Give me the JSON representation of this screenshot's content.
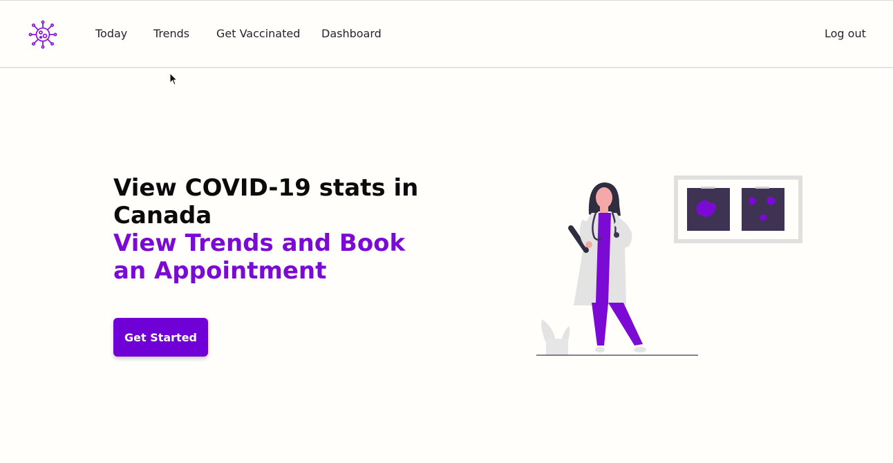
{
  "nav": {
    "logo_icon": "virus-icon",
    "links": [
      "Today",
      "Trends",
      "Get Vaccinated",
      "Dashboard"
    ],
    "logout": "Log out"
  },
  "hero": {
    "title": "View COVID-19 stats in Canada",
    "subtitle": "View Trends and Book an Appointment",
    "cta": "Get Started"
  },
  "illustration": {
    "icon": "doctor-illustration"
  },
  "colors": {
    "accent": "#7b0ad4",
    "button": "#6f00d6",
    "background": "#fffefb",
    "text": "#0b0b0b"
  }
}
